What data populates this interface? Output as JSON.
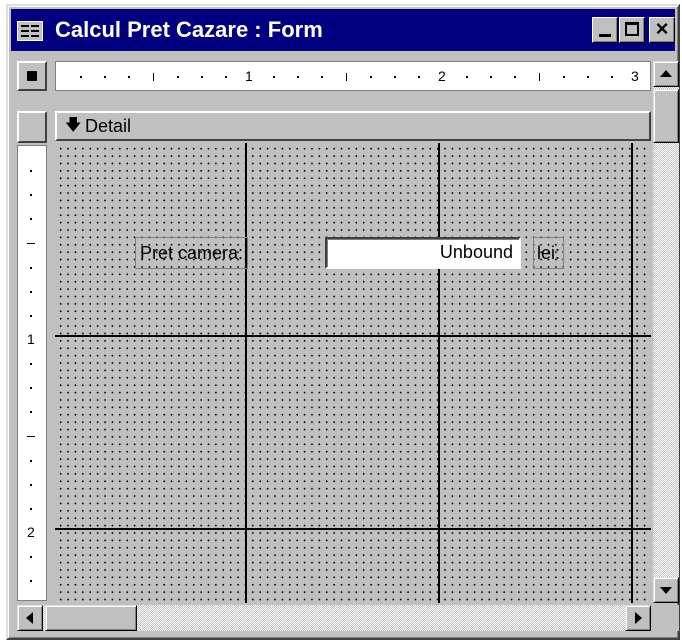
{
  "window": {
    "title": "Calcul Pret Cazare : Form",
    "close_glyph": "×"
  },
  "icons": {
    "app": "form-view-icon",
    "minimize": "minimize-icon",
    "maximize": "maximize-icon",
    "close": "close-icon",
    "form_selector": "form-selector-icon",
    "section": "section-arrow-icon"
  },
  "rulers": {
    "horizontal_numbers": [
      "1",
      "2",
      "3"
    ],
    "vertical_numbers": [
      "1",
      "2"
    ]
  },
  "section": {
    "glyph": "🡇",
    "label": "Detail"
  },
  "controls": {
    "label_text": "Pret camera:",
    "textbox_value": "Unbound",
    "unit_text": "lei:"
  },
  "colors": {
    "titlebar": "#000080",
    "face": "#c0c0c0"
  }
}
